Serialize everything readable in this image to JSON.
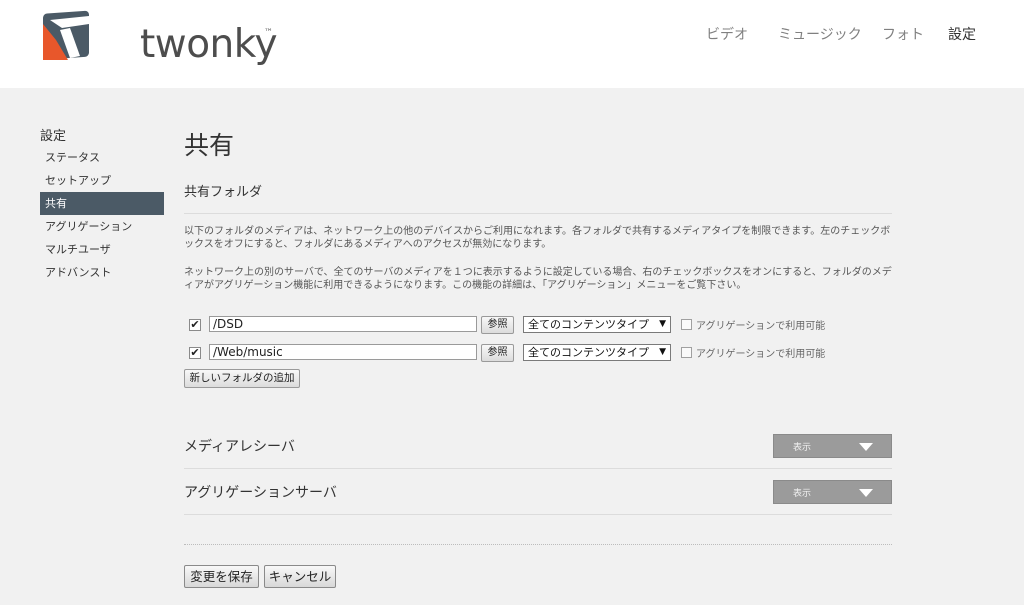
{
  "brand": {
    "name": "twonky",
    "tm": "™"
  },
  "topnav": [
    "ビデオ",
    "ミュージック",
    "フォト",
    "設定"
  ],
  "sidebar": {
    "title": "設定",
    "items": [
      "ステータス",
      "セットアップ",
      "共有",
      "アグリゲーション",
      "マルチユーザ",
      "アドバンスト"
    ],
    "active": "共有"
  },
  "page": {
    "title": "共有",
    "section_title": "共有フォルダ",
    "desc1": "以下のフォルダのメディアは、ネットワーク上の他のデバイスからご利用になれます。各フォルダで共有するメディアタイプを制限できます。左のチェックボックスをオフにすると、フォルダにあるメディアへのアクセスが無効になります。",
    "desc2": "ネットワーク上の別のサーバで、全てのサーバのメディアを１つに表示するように設定している場合、右のチェックボックスをオンにすると、フォルダのメディアがアグリゲーション機能に利用できるようになります。この機能の詳細は、「アグリゲーション」メニューをご覧下さい。"
  },
  "folders": [
    {
      "checked": true,
      "path": "/DSD",
      "browse": "参照",
      "type": "全てのコンテンツタイプ",
      "agg_checked": false,
      "agg_label": "アグリゲーションで利用可能"
    },
    {
      "checked": true,
      "path": "/Web/music",
      "browse": "参照",
      "type": "全てのコンテンツタイプ",
      "agg_checked": false,
      "agg_label": "アグリゲーションで利用可能"
    }
  ],
  "add_folder_label": "新しいフォルダの追加",
  "sections": [
    {
      "title": "メディアレシーバ",
      "button": "表示"
    },
    {
      "title": "アグリゲーションサーバ",
      "button": "表示"
    }
  ],
  "actions": {
    "save": "変更を保存",
    "cancel": "キャンセル"
  },
  "colors": {
    "logo_orange": "#e8572b",
    "logo_dark": "#4b5a66",
    "active_nav_bg": "#4b5a66",
    "collapse_btn": "#9b9b9b"
  }
}
